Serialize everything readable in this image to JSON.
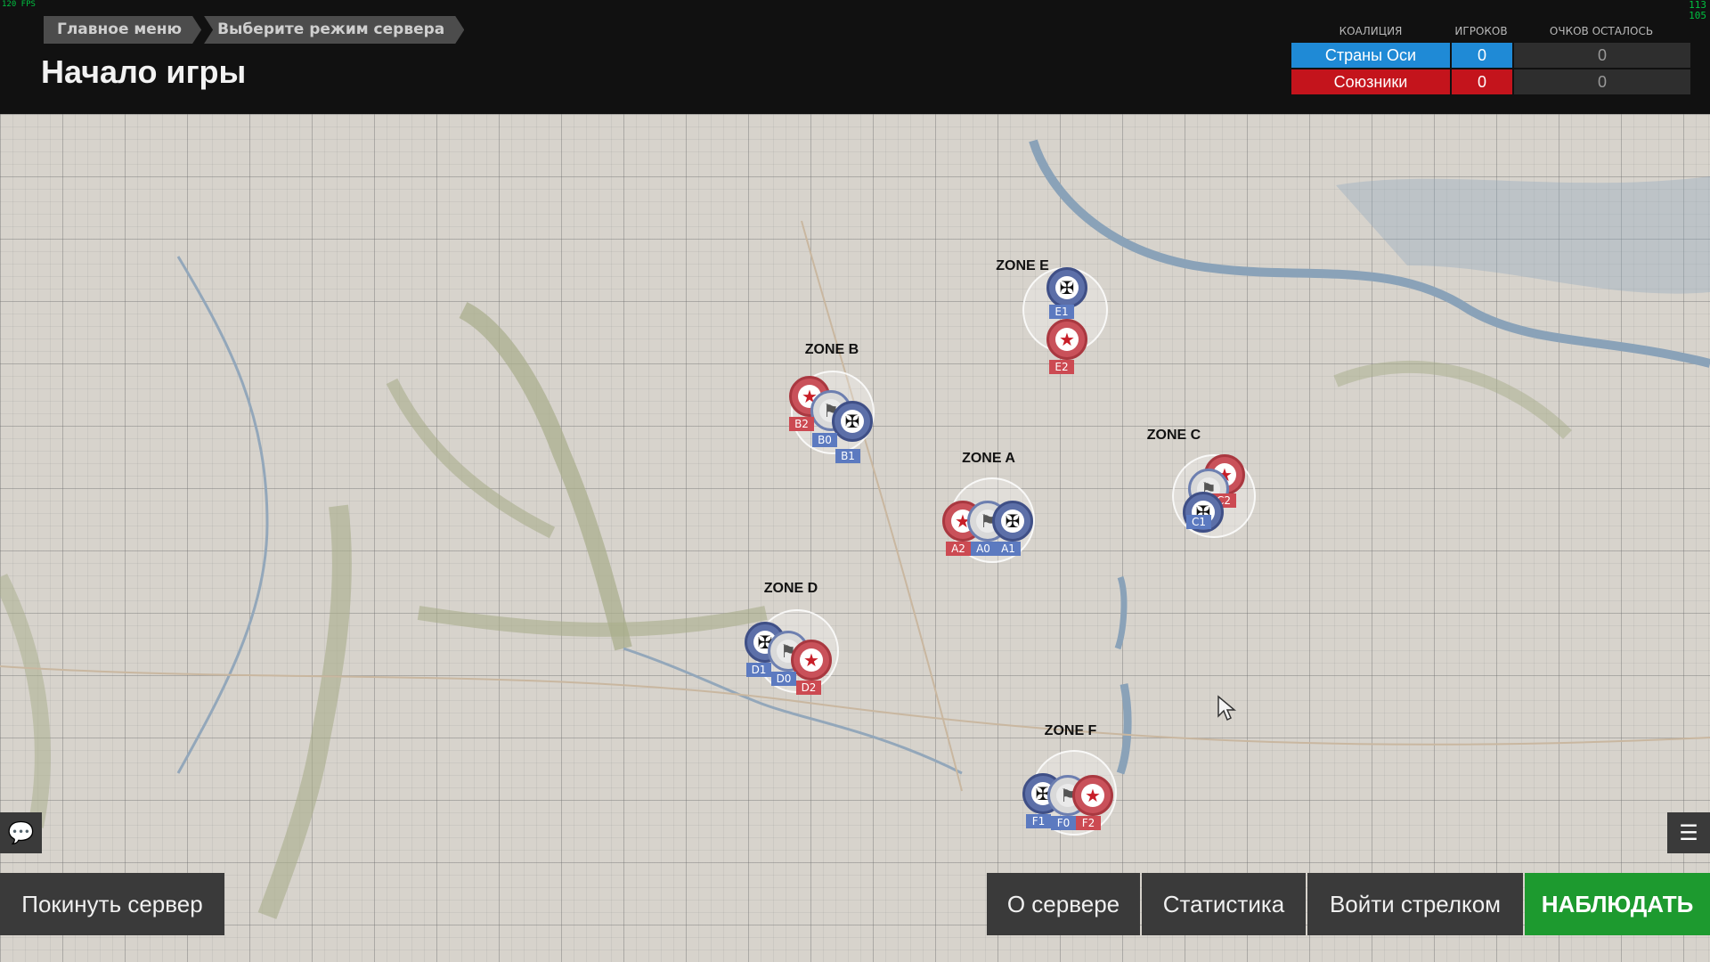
{
  "overlay": {
    "fps_left": "120 FPS",
    "fps_right_1": "113",
    "fps_right_2": "105"
  },
  "breadcrumb": [
    "Главное меню",
    "Выберите режим сервера"
  ],
  "page_title": "Начало игры",
  "scoreboard": {
    "headers": {
      "coalition": "КОАЛИЦИЯ",
      "players": "ИГРОКОВ",
      "points_left": "ОЧКОВ ОСТАЛОСЬ"
    },
    "rows": [
      {
        "name": "Страны Оси",
        "players": "0",
        "points": "0",
        "color": "#1f8ad6"
      },
      {
        "name": "Союзники",
        "players": "0",
        "points": "0",
        "color": "#c4141c"
      }
    ]
  },
  "map": {
    "zones": [
      {
        "label": "ZONE E",
        "markers": [
          {
            "tag": "E1",
            "side": "axis",
            "icon": "cross-icon"
          },
          {
            "tag": "E2",
            "side": "allies",
            "icon": "star-icon"
          }
        ]
      },
      {
        "label": "ZONE B",
        "markers": [
          {
            "tag": "B2",
            "side": "allies",
            "icon": "star-icon"
          },
          {
            "tag": "B0",
            "side": "neutral",
            "icon": "flag-icon"
          },
          {
            "tag": "B1",
            "side": "axis",
            "icon": "cross-icon"
          }
        ]
      },
      {
        "label": "ZONE A",
        "markers": [
          {
            "tag": "A2",
            "side": "allies",
            "icon": "star-icon"
          },
          {
            "tag": "A0",
            "side": "neutral",
            "icon": "flag-icon"
          },
          {
            "tag": "A1",
            "side": "axis",
            "icon": "cross-icon"
          }
        ]
      },
      {
        "label": "ZONE C",
        "markers": [
          {
            "tag": "C2",
            "side": "allies",
            "icon": "star-icon"
          },
          {
            "tag": "C0",
            "side": "neutral",
            "icon": "flag-icon"
          },
          {
            "tag": "C1",
            "side": "axis",
            "icon": "cross-icon"
          }
        ]
      },
      {
        "label": "ZONE D",
        "markers": [
          {
            "tag": "D1",
            "side": "axis",
            "icon": "cross-icon"
          },
          {
            "tag": "D0",
            "side": "neutral",
            "icon": "flag-icon"
          },
          {
            "tag": "D2",
            "side": "allies",
            "icon": "star-icon"
          }
        ]
      },
      {
        "label": "ZONE F",
        "markers": [
          {
            "tag": "F1",
            "side": "axis",
            "icon": "cross-icon"
          },
          {
            "tag": "F0",
            "side": "neutral",
            "icon": "flag-icon"
          },
          {
            "tag": "F2",
            "side": "allies",
            "icon": "star-icon"
          }
        ]
      }
    ]
  },
  "buttons": {
    "leave": "Покинуть сервер",
    "about": "О сервере",
    "stats": "Статистика",
    "gunner": "Войти стрелком",
    "watch": "НАБЛЮДАТЬ"
  },
  "icons": {
    "chat": "chat-icon",
    "list": "list-icon",
    "cursor": "cursor-icon"
  },
  "colors": {
    "watch_button": "#1d9a2f",
    "axis": "#1f8ad6",
    "allies": "#c4141c"
  }
}
